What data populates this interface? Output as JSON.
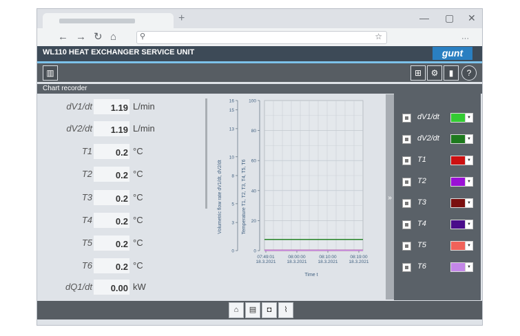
{
  "browser": {
    "new_tab_label": "+",
    "nav": {
      "back": "←",
      "forward": "→",
      "reload": "↻",
      "home": "⌂"
    },
    "search_glyph": "⚲",
    "star_glyph": "☆",
    "menu_glyph": "···",
    "window": {
      "minimize": "—",
      "maximize": "▢",
      "close": "✕"
    }
  },
  "app": {
    "title": "WL110 HEAT EXCHANGER SERVICE UNIT",
    "logo": "gunt",
    "section_title": "Chart recorder"
  },
  "measurements": [
    {
      "label": "dV1/dt",
      "value": "1.19",
      "unit": "L/min"
    },
    {
      "label": "dV2/dt",
      "value": "1.19",
      "unit": "L/min"
    },
    {
      "label": "T1",
      "value": "0.2",
      "unit": "°C"
    },
    {
      "label": "T2",
      "value": "0.2",
      "unit": "°C"
    },
    {
      "label": "T3",
      "value": "0.2",
      "unit": "°C"
    },
    {
      "label": "T4",
      "value": "0.2",
      "unit": "°C"
    },
    {
      "label": "T5",
      "value": "0.2",
      "unit": "°C"
    },
    {
      "label": "T6",
      "value": "0.2",
      "unit": "°C"
    },
    {
      "label": "dQ1/dt",
      "value": "0.00",
      "unit": "kW"
    }
  ],
  "legend": [
    {
      "label": "dV1/dt",
      "color": "#33cc33"
    },
    {
      "label": "dV2/dt",
      "color": "#1e7a1e"
    },
    {
      "label": "T1",
      "color": "#cc1111"
    },
    {
      "label": "T2",
      "color": "#9a10d6"
    },
    {
      "label": "T3",
      "color": "#7a0f0f"
    },
    {
      "label": "T4",
      "color": "#4a0c8a"
    },
    {
      "label": "T5",
      "color": "#f0625a"
    },
    {
      "label": "T6",
      "color": "#c487e8"
    }
  ],
  "collapse_glyph": "»",
  "chart_data": {
    "type": "line",
    "xlabel": "Time t",
    "ylabel_left": "Volumetric flow rate dV1/dt, dV2/dt",
    "ylabel_right": "Temperature T1, T2, T3, T4, T5, T6",
    "y1lim": [
      0,
      16
    ],
    "y1ticks": [
      0,
      3,
      5,
      8,
      10,
      13,
      15,
      16
    ],
    "y2lim": [
      0,
      100
    ],
    "y2ticks": [
      0,
      20,
      40,
      60,
      80,
      100
    ],
    "x_tick_labels": [
      {
        "time": "07:49:01",
        "date": "18.3.2021"
      },
      {
        "time": "08:00:00",
        "date": "18.3.2021"
      },
      {
        "time": "08:10:00",
        "date": "18.3.2021"
      },
      {
        "time": "08:19:00",
        "date": "18.3.2021"
      }
    ],
    "grid": true,
    "series": [
      {
        "name": "dV1/dt",
        "axis": "left",
        "value": 1.19,
        "color": "#33cc33"
      },
      {
        "name": "dV2/dt",
        "axis": "left",
        "value": 1.19,
        "color": "#1e7a1e"
      },
      {
        "name": "T1",
        "axis": "right",
        "value": 0.2,
        "color": "#cc1111"
      },
      {
        "name": "T2",
        "axis": "right",
        "value": 0.2,
        "color": "#9a10d6"
      },
      {
        "name": "T3",
        "axis": "right",
        "value": 0.2,
        "color": "#7a0f0f"
      },
      {
        "name": "T4",
        "axis": "right",
        "value": 0.2,
        "color": "#4a0c8a"
      },
      {
        "name": "T5",
        "axis": "right",
        "value": 0.2,
        "color": "#f0625a"
      },
      {
        "name": "T6",
        "axis": "right",
        "value": 0.2,
        "color": "#c487e8"
      }
    ]
  },
  "bottom_buttons": [
    {
      "icon": "home-icon",
      "glyph": "⌂"
    },
    {
      "icon": "diagram-icon",
      "glyph": "▤"
    },
    {
      "icon": "camera-icon",
      "glyph": "◘"
    },
    {
      "icon": "chart-recorder-icon",
      "glyph": "⌇"
    }
  ],
  "toolbar_glyphs": {
    "chart": "▥",
    "network": "⊞",
    "settings": "⚙",
    "device": "▮",
    "help": "?"
  }
}
